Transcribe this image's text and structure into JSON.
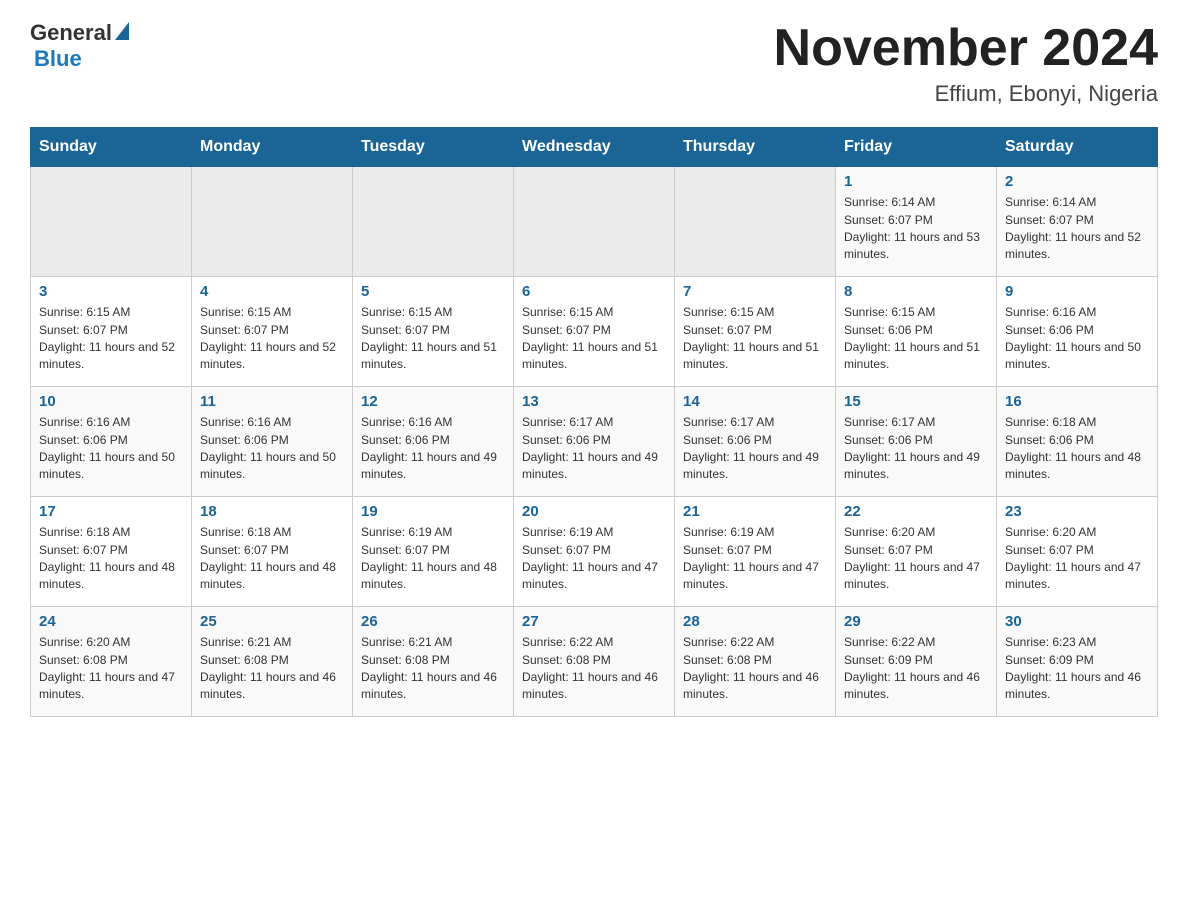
{
  "logo": {
    "general": "General",
    "blue": "Blue"
  },
  "title": "November 2024",
  "location": "Effium, Ebonyi, Nigeria",
  "days_of_week": [
    "Sunday",
    "Monday",
    "Tuesday",
    "Wednesday",
    "Thursday",
    "Friday",
    "Saturday"
  ],
  "weeks": [
    [
      {
        "day": "",
        "sunrise": "",
        "sunset": "",
        "daylight": ""
      },
      {
        "day": "",
        "sunrise": "",
        "sunset": "",
        "daylight": ""
      },
      {
        "day": "",
        "sunrise": "",
        "sunset": "",
        "daylight": ""
      },
      {
        "day": "",
        "sunrise": "",
        "sunset": "",
        "daylight": ""
      },
      {
        "day": "",
        "sunrise": "",
        "sunset": "",
        "daylight": ""
      },
      {
        "day": "1",
        "sunrise": "Sunrise: 6:14 AM",
        "sunset": "Sunset: 6:07 PM",
        "daylight": "Daylight: 11 hours and 53 minutes."
      },
      {
        "day": "2",
        "sunrise": "Sunrise: 6:14 AM",
        "sunset": "Sunset: 6:07 PM",
        "daylight": "Daylight: 11 hours and 52 minutes."
      }
    ],
    [
      {
        "day": "3",
        "sunrise": "Sunrise: 6:15 AM",
        "sunset": "Sunset: 6:07 PM",
        "daylight": "Daylight: 11 hours and 52 minutes."
      },
      {
        "day": "4",
        "sunrise": "Sunrise: 6:15 AM",
        "sunset": "Sunset: 6:07 PM",
        "daylight": "Daylight: 11 hours and 52 minutes."
      },
      {
        "day": "5",
        "sunrise": "Sunrise: 6:15 AM",
        "sunset": "Sunset: 6:07 PM",
        "daylight": "Daylight: 11 hours and 51 minutes."
      },
      {
        "day": "6",
        "sunrise": "Sunrise: 6:15 AM",
        "sunset": "Sunset: 6:07 PM",
        "daylight": "Daylight: 11 hours and 51 minutes."
      },
      {
        "day": "7",
        "sunrise": "Sunrise: 6:15 AM",
        "sunset": "Sunset: 6:07 PM",
        "daylight": "Daylight: 11 hours and 51 minutes."
      },
      {
        "day": "8",
        "sunrise": "Sunrise: 6:15 AM",
        "sunset": "Sunset: 6:06 PM",
        "daylight": "Daylight: 11 hours and 51 minutes."
      },
      {
        "day": "9",
        "sunrise": "Sunrise: 6:16 AM",
        "sunset": "Sunset: 6:06 PM",
        "daylight": "Daylight: 11 hours and 50 minutes."
      }
    ],
    [
      {
        "day": "10",
        "sunrise": "Sunrise: 6:16 AM",
        "sunset": "Sunset: 6:06 PM",
        "daylight": "Daylight: 11 hours and 50 minutes."
      },
      {
        "day": "11",
        "sunrise": "Sunrise: 6:16 AM",
        "sunset": "Sunset: 6:06 PM",
        "daylight": "Daylight: 11 hours and 50 minutes."
      },
      {
        "day": "12",
        "sunrise": "Sunrise: 6:16 AM",
        "sunset": "Sunset: 6:06 PM",
        "daylight": "Daylight: 11 hours and 49 minutes."
      },
      {
        "day": "13",
        "sunrise": "Sunrise: 6:17 AM",
        "sunset": "Sunset: 6:06 PM",
        "daylight": "Daylight: 11 hours and 49 minutes."
      },
      {
        "day": "14",
        "sunrise": "Sunrise: 6:17 AM",
        "sunset": "Sunset: 6:06 PM",
        "daylight": "Daylight: 11 hours and 49 minutes."
      },
      {
        "day": "15",
        "sunrise": "Sunrise: 6:17 AM",
        "sunset": "Sunset: 6:06 PM",
        "daylight": "Daylight: 11 hours and 49 minutes."
      },
      {
        "day": "16",
        "sunrise": "Sunrise: 6:18 AM",
        "sunset": "Sunset: 6:06 PM",
        "daylight": "Daylight: 11 hours and 48 minutes."
      }
    ],
    [
      {
        "day": "17",
        "sunrise": "Sunrise: 6:18 AM",
        "sunset": "Sunset: 6:07 PM",
        "daylight": "Daylight: 11 hours and 48 minutes."
      },
      {
        "day": "18",
        "sunrise": "Sunrise: 6:18 AM",
        "sunset": "Sunset: 6:07 PM",
        "daylight": "Daylight: 11 hours and 48 minutes."
      },
      {
        "day": "19",
        "sunrise": "Sunrise: 6:19 AM",
        "sunset": "Sunset: 6:07 PM",
        "daylight": "Daylight: 11 hours and 48 minutes."
      },
      {
        "day": "20",
        "sunrise": "Sunrise: 6:19 AM",
        "sunset": "Sunset: 6:07 PM",
        "daylight": "Daylight: 11 hours and 47 minutes."
      },
      {
        "day": "21",
        "sunrise": "Sunrise: 6:19 AM",
        "sunset": "Sunset: 6:07 PM",
        "daylight": "Daylight: 11 hours and 47 minutes."
      },
      {
        "day": "22",
        "sunrise": "Sunrise: 6:20 AM",
        "sunset": "Sunset: 6:07 PM",
        "daylight": "Daylight: 11 hours and 47 minutes."
      },
      {
        "day": "23",
        "sunrise": "Sunrise: 6:20 AM",
        "sunset": "Sunset: 6:07 PM",
        "daylight": "Daylight: 11 hours and 47 minutes."
      }
    ],
    [
      {
        "day": "24",
        "sunrise": "Sunrise: 6:20 AM",
        "sunset": "Sunset: 6:08 PM",
        "daylight": "Daylight: 11 hours and 47 minutes."
      },
      {
        "day": "25",
        "sunrise": "Sunrise: 6:21 AM",
        "sunset": "Sunset: 6:08 PM",
        "daylight": "Daylight: 11 hours and 46 minutes."
      },
      {
        "day": "26",
        "sunrise": "Sunrise: 6:21 AM",
        "sunset": "Sunset: 6:08 PM",
        "daylight": "Daylight: 11 hours and 46 minutes."
      },
      {
        "day": "27",
        "sunrise": "Sunrise: 6:22 AM",
        "sunset": "Sunset: 6:08 PM",
        "daylight": "Daylight: 11 hours and 46 minutes."
      },
      {
        "day": "28",
        "sunrise": "Sunrise: 6:22 AM",
        "sunset": "Sunset: 6:08 PM",
        "daylight": "Daylight: 11 hours and 46 minutes."
      },
      {
        "day": "29",
        "sunrise": "Sunrise: 6:22 AM",
        "sunset": "Sunset: 6:09 PM",
        "daylight": "Daylight: 11 hours and 46 minutes."
      },
      {
        "day": "30",
        "sunrise": "Sunrise: 6:23 AM",
        "sunset": "Sunset: 6:09 PM",
        "daylight": "Daylight: 11 hours and 46 minutes."
      }
    ]
  ]
}
